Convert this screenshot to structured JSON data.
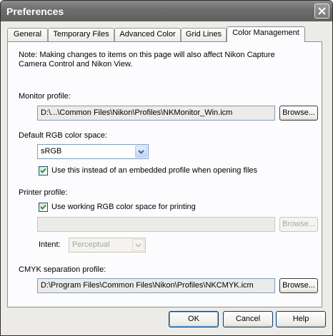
{
  "window": {
    "title": "Preferences"
  },
  "tabs": [
    {
      "label": "General"
    },
    {
      "label": "Temporary Files"
    },
    {
      "label": "Advanced Color"
    },
    {
      "label": "Grid Lines"
    },
    {
      "label": "Color Management",
      "active": true
    }
  ],
  "panel": {
    "note": "Note: Making changes to items on this page will also affect Nikon Capture Camera Control and Nikon View.",
    "monitor_profile": {
      "label": "Monitor profile:",
      "value": "D:\\...\\Common Files\\Nikon\\Profiles\\NKMonitor_Win.icm",
      "browse_label": "Browse..."
    },
    "rgb_space": {
      "label": "Default RGB color space:",
      "selected": "sRGB",
      "checkbox_label": "Use this instead of an embedded profile when opening files",
      "checked": true
    },
    "printer_profile": {
      "label": "Printer profile:",
      "checkbox_label": "Use working RGB color space for printing",
      "checked": true,
      "value": "",
      "browse_label": "Browse...",
      "intent_label": "Intent:",
      "intent_selected": "Perceptual"
    },
    "cmyk_profile": {
      "label": "CMYK separation profile:",
      "value": "D:\\Program Files\\Common Files\\Nikon\\Profiles\\NKCMYK.icm",
      "browse_label": "Browse..."
    }
  },
  "buttons": {
    "ok": "OK",
    "cancel": "Cancel",
    "help": "Help"
  }
}
